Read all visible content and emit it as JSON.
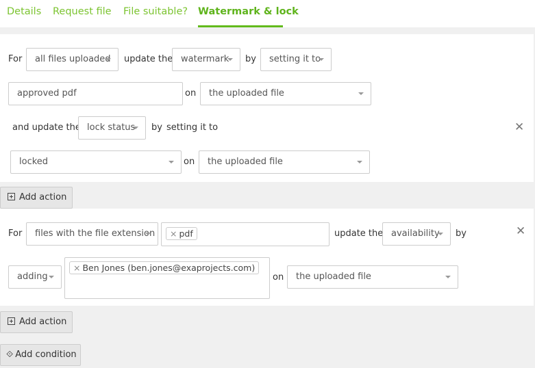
{
  "tabs": [
    {
      "label": "Details"
    },
    {
      "label": "Request file"
    },
    {
      "label": "File suitable?"
    },
    {
      "label": "Watermark & lock",
      "active": true
    }
  ],
  "accent": "#62ba1c",
  "condition1": {
    "for_label": "For",
    "for_value": "all files uploaded",
    "update_label": "update the",
    "field1": "watermark",
    "by_label": "by",
    "method1": "setting it to",
    "value1": "approved pdf",
    "on_label": "on",
    "target1": "the uploaded file",
    "and_update_label": "and update the",
    "field2": "lock status",
    "by2_label": "by",
    "method2": "setting it to",
    "value2": "locked",
    "target2": "the uploaded file",
    "remove_icon": "close-icon"
  },
  "add_action_label": "Add action",
  "condition2": {
    "for_label": "For",
    "for_value": "files with the file extension",
    "extension_tag": "pdf",
    "update_label": "update the",
    "field": "availability",
    "by_label": "by",
    "method": "adding",
    "user_tag": "Ben Jones (ben.jones@exaprojects.com)",
    "on_label": "on",
    "target": "the uploaded file",
    "remove_icon": "close-icon"
  },
  "add_condition_label": "Add condition"
}
